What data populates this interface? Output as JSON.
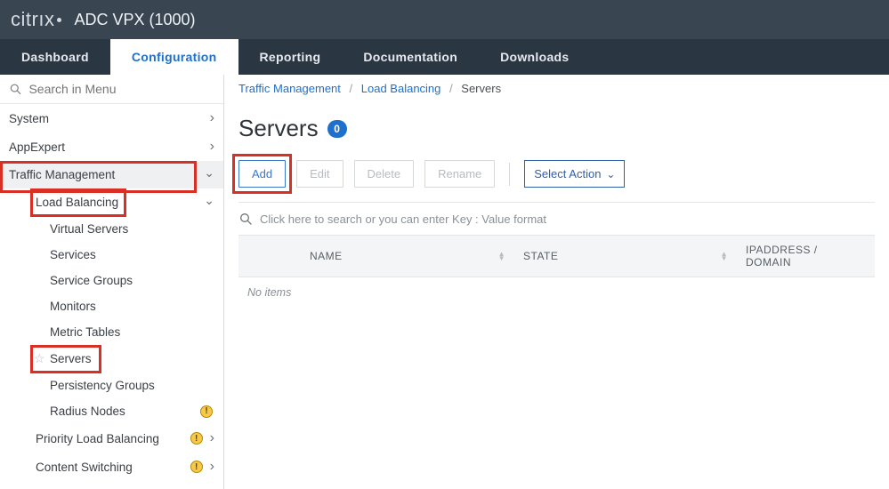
{
  "brand": {
    "logo_word": "citrıx",
    "product": "ADC VPX (1000)"
  },
  "nav": {
    "tabs": [
      {
        "label": "Dashboard"
      },
      {
        "label": "Configuration"
      },
      {
        "label": "Reporting"
      },
      {
        "label": "Documentation"
      },
      {
        "label": "Downloads"
      }
    ],
    "active_index": 1
  },
  "sidebar": {
    "search_placeholder": "Search in Menu",
    "items": [
      {
        "label": "System",
        "level": 0,
        "chev": "right"
      },
      {
        "label": "AppExpert",
        "level": 0,
        "chev": "right"
      },
      {
        "label": "Traffic Management",
        "level": 0,
        "chev": "down"
      },
      {
        "label": "Load Balancing",
        "level": 1,
        "chev": "down"
      },
      {
        "label": "Virtual Servers",
        "level": 2
      },
      {
        "label": "Services",
        "level": 2
      },
      {
        "label": "Service Groups",
        "level": 2
      },
      {
        "label": "Monitors",
        "level": 2
      },
      {
        "label": "Metric Tables",
        "level": 2
      },
      {
        "label": "Servers",
        "level": 2
      },
      {
        "label": "Persistency Groups",
        "level": 2
      },
      {
        "label": "Radius Nodes",
        "level": 2,
        "warn": true
      },
      {
        "label": "Priority Load Balancing",
        "level": 1,
        "chev": "right",
        "warn": true
      },
      {
        "label": "Content Switching",
        "level": 1,
        "chev": "right",
        "warn": true
      }
    ]
  },
  "breadcrumb": {
    "parts": [
      {
        "label": "Traffic Management",
        "link": true
      },
      {
        "label": "Load Balancing",
        "link": true
      },
      {
        "label": "Servers",
        "link": false
      }
    ]
  },
  "page": {
    "title": "Servers",
    "count": "0"
  },
  "toolbar": {
    "add": "Add",
    "edit": "Edit",
    "delete": "Delete",
    "rename": "Rename",
    "select_action": "Select Action"
  },
  "filter": {
    "placeholder": "Click here to search or you can enter Key : Value format"
  },
  "table": {
    "columns": {
      "name": "NAME",
      "state": "STATE",
      "ip": "IPADDRESS / DOMAIN"
    },
    "no_items": "No items"
  }
}
